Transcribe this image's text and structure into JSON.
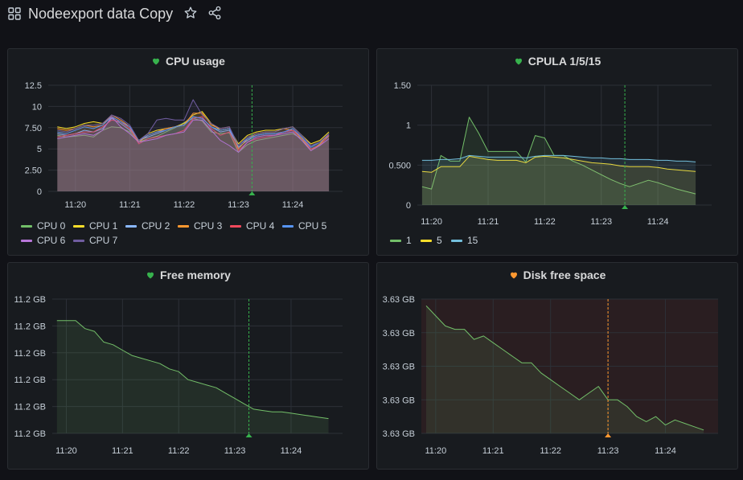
{
  "dashboard": {
    "title": "Nodeexport data Copy",
    "icons": [
      "apps-grid-icon",
      "star-icon",
      "share-icon"
    ]
  },
  "colors": {
    "background": "#111217",
    "panel": "#181b1f",
    "grid": "#2c3037",
    "health_ok": "#37b24d",
    "health_warn": "#ff9830",
    "annotation_green": "#37b24d",
    "annotation_orange": "#ff9830"
  },
  "panels": {
    "cpu_usage": {
      "title": "CPU usage",
      "health_icon": "heart-icon"
    },
    "cpula": {
      "title": "CPULA 1/5/15",
      "health_icon": "heart-icon"
    },
    "free_memory": {
      "title": "Free memory",
      "health_icon": "heart-icon"
    },
    "disk_free": {
      "title": "Disk free space",
      "health_icon": "heart-icon"
    }
  },
  "chart_data": [
    {
      "id": "cpu_usage",
      "type": "area",
      "title": "CPU usage",
      "x_ticks": [
        "11:20",
        "11:21",
        "11:22",
        "11:23",
        "11:24"
      ],
      "x": [
        "11:19:40",
        "11:19:50",
        "11:20:00",
        "11:20:10",
        "11:20:20",
        "11:20:30",
        "11:20:40",
        "11:20:50",
        "11:21:00",
        "11:21:10",
        "11:21:20",
        "11:21:30",
        "11:21:40",
        "11:21:50",
        "11:22:00",
        "11:22:10",
        "11:22:20",
        "11:22:30",
        "11:22:40",
        "11:22:50",
        "11:23:00",
        "11:23:10",
        "11:23:20",
        "11:23:30",
        "11:23:40",
        "11:23:50",
        "11:24:00",
        "11:24:10",
        "11:24:20",
        "11:24:30",
        "11:24:40"
      ],
      "y_ticks": [
        "0",
        "2.50",
        "5",
        "7.50",
        "10",
        "12.5"
      ],
      "ylim": [
        0,
        12.5
      ],
      "series": [
        {
          "name": "CPU 0",
          "color": "#73bf69",
          "values": [
            6.6,
            6.4,
            6.5,
            6.6,
            6.4,
            7.2,
            7.6,
            7.5,
            7.0,
            5.8,
            6.2,
            6.5,
            7.0,
            7.5,
            8.1,
            8.6,
            8.3,
            7.0,
            6.8,
            6.9,
            4.6,
            5.5,
            6.0,
            6.2,
            6.4,
            6.6,
            6.8,
            6.2,
            5.0,
            5.5,
            6.5
          ]
        },
        {
          "name": "CPU 1",
          "color": "#fade2a",
          "values": [
            7.6,
            7.4,
            7.6,
            8.0,
            8.2,
            8.0,
            8.8,
            8.2,
            7.4,
            6.0,
            6.8,
            7.2,
            7.4,
            7.6,
            8.0,
            9.0,
            9.4,
            8.0,
            7.2,
            7.4,
            5.6,
            6.6,
            7.0,
            7.2,
            7.2,
            7.4,
            7.6,
            6.6,
            5.6,
            6.0,
            7.0
          ]
        },
        {
          "name": "CPU 2",
          "color": "#8ab8ff",
          "values": [
            6.8,
            6.6,
            6.8,
            7.2,
            7.0,
            7.4,
            8.6,
            8.0,
            7.2,
            6.0,
            6.4,
            6.8,
            7.2,
            7.6,
            7.8,
            8.8,
            8.6,
            7.6,
            7.0,
            7.2,
            5.2,
            6.0,
            6.6,
            6.8,
            6.8,
            7.0,
            7.2,
            6.4,
            5.2,
            5.8,
            6.6
          ]
        },
        {
          "name": "CPU 3",
          "color": "#ff9830",
          "values": [
            7.4,
            7.2,
            7.4,
            7.8,
            7.6,
            7.8,
            9.0,
            8.4,
            7.6,
            5.8,
            6.6,
            7.0,
            7.4,
            7.6,
            7.8,
            9.2,
            9.2,
            7.8,
            7.4,
            7.6,
            5.0,
            6.2,
            6.8,
            7.0,
            7.0,
            7.4,
            7.2,
            6.2,
            4.8,
            5.6,
            6.8
          ]
        },
        {
          "name": "CPU 4",
          "color": "#f2495c",
          "values": [
            6.4,
            6.6,
            6.8,
            7.0,
            7.0,
            7.6,
            8.4,
            8.2,
            7.4,
            5.6,
            6.2,
            6.4,
            6.6,
            6.8,
            7.2,
            8.6,
            8.8,
            7.4,
            6.6,
            7.0,
            4.8,
            5.8,
            6.2,
            6.4,
            6.6,
            7.0,
            7.2,
            6.4,
            5.0,
            5.4,
            6.6
          ]
        },
        {
          "name": "CPU 5",
          "color": "#5794f2",
          "values": [
            7.0,
            6.8,
            7.2,
            7.6,
            7.4,
            7.8,
            8.8,
            8.2,
            7.6,
            6.0,
            6.6,
            7.0,
            7.2,
            7.6,
            7.8,
            8.8,
            8.6,
            7.6,
            7.2,
            7.4,
            5.4,
            6.2,
            6.6,
            6.8,
            6.8,
            7.0,
            7.4,
            6.4,
            5.2,
            5.8,
            6.8
          ]
        },
        {
          "name": "CPU 6",
          "color": "#b877d9",
          "values": [
            6.2,
            6.4,
            6.6,
            6.8,
            6.6,
            7.2,
            8.8,
            7.6,
            6.8,
            5.8,
            6.0,
            6.2,
            6.6,
            6.8,
            7.0,
            8.4,
            8.4,
            7.2,
            6.0,
            5.4,
            4.6,
            5.8,
            6.4,
            6.6,
            6.6,
            6.8,
            7.0,
            6.0,
            4.8,
            5.4,
            6.2
          ]
        },
        {
          "name": "CPU 7",
          "color": "#705da0",
          "values": [
            7.2,
            7.0,
            7.4,
            7.8,
            7.8,
            8.0,
            9.0,
            8.6,
            7.8,
            6.0,
            6.8,
            8.4,
            8.6,
            8.4,
            8.4,
            10.8,
            9.0,
            8.0,
            7.4,
            7.6,
            5.4,
            6.4,
            6.8,
            7.0,
            7.0,
            7.4,
            7.6,
            6.6,
            5.4,
            5.8,
            6.8
          ]
        }
      ],
      "annotation_time": "11:23:15",
      "legend": "bottom"
    },
    {
      "id": "cpula",
      "type": "area",
      "title": "CPULA 1/5/15",
      "x_ticks": [
        "11:20",
        "11:21",
        "11:22",
        "11:23",
        "11:24"
      ],
      "x": [
        "11:19:50",
        "11:20:00",
        "11:20:10",
        "11:20:20",
        "11:20:30",
        "11:20:40",
        "11:20:50",
        "11:21:00",
        "11:21:10",
        "11:21:20",
        "11:21:30",
        "11:21:40",
        "11:21:50",
        "11:22:00",
        "11:22:10",
        "11:22:20",
        "11:22:30",
        "11:22:40",
        "11:22:50",
        "11:23:00",
        "11:23:10",
        "11:23:20",
        "11:23:30",
        "11:23:40",
        "11:23:50",
        "11:24:00",
        "11:24:10",
        "11:24:20",
        "11:24:30",
        "11:24:40"
      ],
      "y_ticks": [
        "0",
        "0.500",
        "1",
        "1.50"
      ],
      "ylim": [
        0,
        1.5
      ],
      "series": [
        {
          "name": "1",
          "color": "#73bf69",
          "values": [
            0.23,
            0.2,
            0.62,
            0.55,
            0.55,
            1.1,
            0.9,
            0.67,
            0.67,
            0.67,
            0.67,
            0.54,
            0.87,
            0.84,
            0.62,
            0.62,
            0.55,
            0.5,
            0.44,
            0.38,
            0.32,
            0.27,
            0.23,
            0.27,
            0.31,
            0.28,
            0.24,
            0.2,
            0.17,
            0.14
          ]
        },
        {
          "name": "5",
          "color": "#fade2a",
          "values": [
            0.42,
            0.41,
            0.48,
            0.48,
            0.48,
            0.61,
            0.59,
            0.57,
            0.56,
            0.56,
            0.56,
            0.53,
            0.6,
            0.61,
            0.6,
            0.59,
            0.57,
            0.55,
            0.53,
            0.52,
            0.51,
            0.49,
            0.48,
            0.48,
            0.48,
            0.47,
            0.45,
            0.44,
            0.43,
            0.42
          ]
        },
        {
          "name": "15",
          "color": "#73bfdc",
          "values": [
            0.56,
            0.56,
            0.57,
            0.57,
            0.58,
            0.62,
            0.61,
            0.6,
            0.6,
            0.6,
            0.6,
            0.59,
            0.61,
            0.62,
            0.62,
            0.62,
            0.61,
            0.6,
            0.59,
            0.59,
            0.58,
            0.58,
            0.57,
            0.57,
            0.57,
            0.56,
            0.56,
            0.55,
            0.55,
            0.54
          ]
        }
      ],
      "annotation_time": "11:23:25",
      "legend": "bottom"
    },
    {
      "id": "free_memory",
      "type": "area",
      "title": "Free memory",
      "x_ticks": [
        "11:20",
        "11:21",
        "11:22",
        "11:23",
        "11:24"
      ],
      "x": [
        "11:19:50",
        "11:20:00",
        "11:20:10",
        "11:20:20",
        "11:20:30",
        "11:20:40",
        "11:20:50",
        "11:21:00",
        "11:21:10",
        "11:21:20",
        "11:21:30",
        "11:21:40",
        "11:21:50",
        "11:22:00",
        "11:22:10",
        "11:22:20",
        "11:22:30",
        "11:22:40",
        "11:22:50",
        "11:23:00",
        "11:23:10",
        "11:23:20",
        "11:23:30",
        "11:23:40",
        "11:23:50",
        "11:24:00",
        "11:24:10",
        "11:24:20",
        "11:24:30",
        "11:24:40"
      ],
      "y_ticks": [
        "11.2 GB",
        "11.2 GB",
        "11.2 GB",
        "11.2 GB",
        "11.2 GB",
        "11.2 GB"
      ],
      "ylim": [
        0,
        5
      ],
      "series": [
        {
          "name": "Free memory",
          "color": "#73bf69",
          "values": [
            4.2,
            4.2,
            4.2,
            3.9,
            3.8,
            3.4,
            3.3,
            3.1,
            2.9,
            2.8,
            2.7,
            2.6,
            2.4,
            2.3,
            2.0,
            1.9,
            1.8,
            1.7,
            1.5,
            1.3,
            1.1,
            0.9,
            0.85,
            0.8,
            0.8,
            0.75,
            0.7,
            0.65,
            0.6,
            0.55
          ]
        }
      ],
      "annotation_time": "11:23:15",
      "legend": "none"
    },
    {
      "id": "disk_free",
      "type": "area",
      "title": "Disk free space",
      "x_ticks": [
        "11:20",
        "11:21",
        "11:22",
        "11:23",
        "11:24"
      ],
      "x": [
        "11:19:50",
        "11:20:00",
        "11:20:10",
        "11:20:20",
        "11:20:30",
        "11:20:40",
        "11:20:50",
        "11:21:00",
        "11:21:10",
        "11:21:20",
        "11:21:30",
        "11:21:40",
        "11:21:50",
        "11:22:00",
        "11:22:10",
        "11:22:20",
        "11:22:30",
        "11:22:40",
        "11:22:50",
        "11:23:00",
        "11:23:10",
        "11:23:20",
        "11:23:30",
        "11:23:40",
        "11:23:50",
        "11:24:00",
        "11:24:10",
        "11:24:20",
        "11:24:30",
        "11:24:40"
      ],
      "y_ticks": [
        "3.63 GB",
        "3.63 GB",
        "3.63 GB",
        "3.63 GB",
        "3.63 GB"
      ],
      "ylim": [
        0,
        4
      ],
      "series": [
        {
          "name": "Disk free space",
          "color": "#73bf69",
          "values": [
            3.8,
            3.5,
            3.2,
            3.1,
            3.1,
            2.8,
            2.9,
            2.7,
            2.5,
            2.3,
            2.1,
            2.1,
            1.8,
            1.6,
            1.4,
            1.2,
            1.0,
            1.2,
            1.4,
            1.0,
            1.0,
            0.8,
            0.5,
            0.35,
            0.5,
            0.25,
            0.4,
            0.3,
            0.2,
            0.1
          ]
        }
      ],
      "annotation_time": "11:23:00",
      "legend": "none"
    }
  ]
}
